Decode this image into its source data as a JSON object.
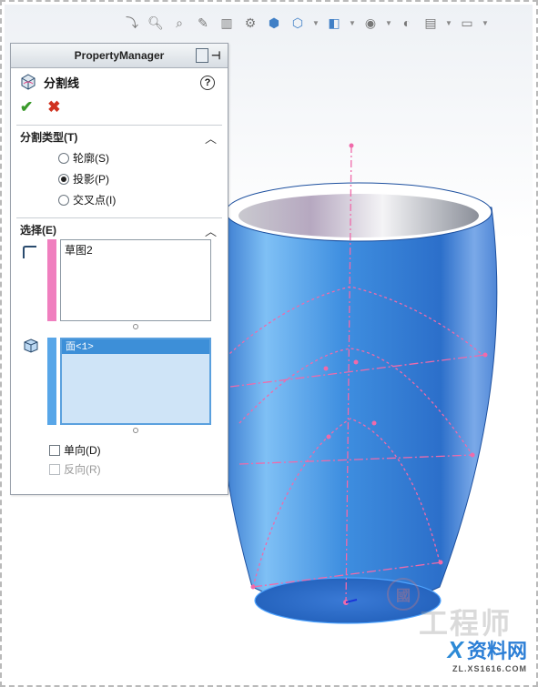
{
  "property_manager": {
    "header_title": "PropertyManager",
    "feature_title": "分割线",
    "help": "?",
    "ok": "✔",
    "cancel": "✖",
    "split_type": {
      "heading": "分割类型(T)",
      "options": [
        {
          "label": "轮廓(S)",
          "selected": false
        },
        {
          "label": "投影(P)",
          "selected": true
        },
        {
          "label": "交叉点(I)",
          "selected": false
        }
      ]
    },
    "selections": {
      "heading": "选择(E)",
      "sketch_item": "草图2",
      "face_item": "面<1>",
      "single_direction": "单向(D)",
      "reverse_direction": "反向(R)"
    }
  },
  "watermark": {
    "chars": "工程师",
    "seal": "國",
    "site_name": "资料网",
    "site_url": "ZL.XS1616.COM"
  },
  "colors": {
    "sketch_bar": "#f07fbf",
    "face_bar": "#58a6e8",
    "cup_blue": "#3f8fe0",
    "sketch_lines": "#f06aaa",
    "selection_highlight": "#3d8fd8"
  }
}
